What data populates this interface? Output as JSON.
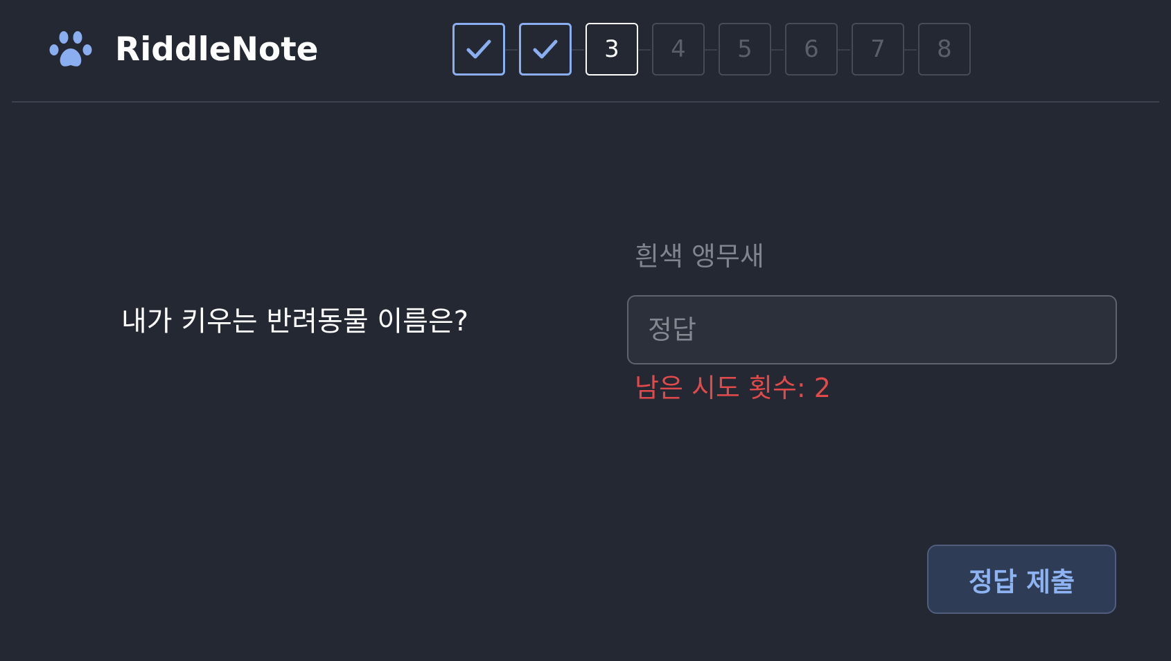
{
  "header": {
    "brand": "RiddleNote",
    "logo_icon": "paw-icon",
    "accent_color": "#8aaef0"
  },
  "stepper": {
    "current_step": 3,
    "steps": [
      {
        "label": "",
        "status": "done",
        "icon": "check-icon"
      },
      {
        "label": "",
        "status": "done",
        "icon": "check-icon"
      },
      {
        "label": "3",
        "status": "current"
      },
      {
        "label": "4",
        "status": "todo"
      },
      {
        "label": "5",
        "status": "todo"
      },
      {
        "label": "6",
        "status": "todo"
      },
      {
        "label": "7",
        "status": "todo"
      },
      {
        "label": "8",
        "status": "todo"
      }
    ]
  },
  "main": {
    "question": "내가 키우는 반려동물 이름은?",
    "hint": "흰색 앵무새",
    "answer_placeholder": "정답",
    "answer_value": "",
    "attempts_text": "남은 시도 횟수: 2",
    "attempts_color": "#e04a4a",
    "submit_label": "정답 제출"
  }
}
